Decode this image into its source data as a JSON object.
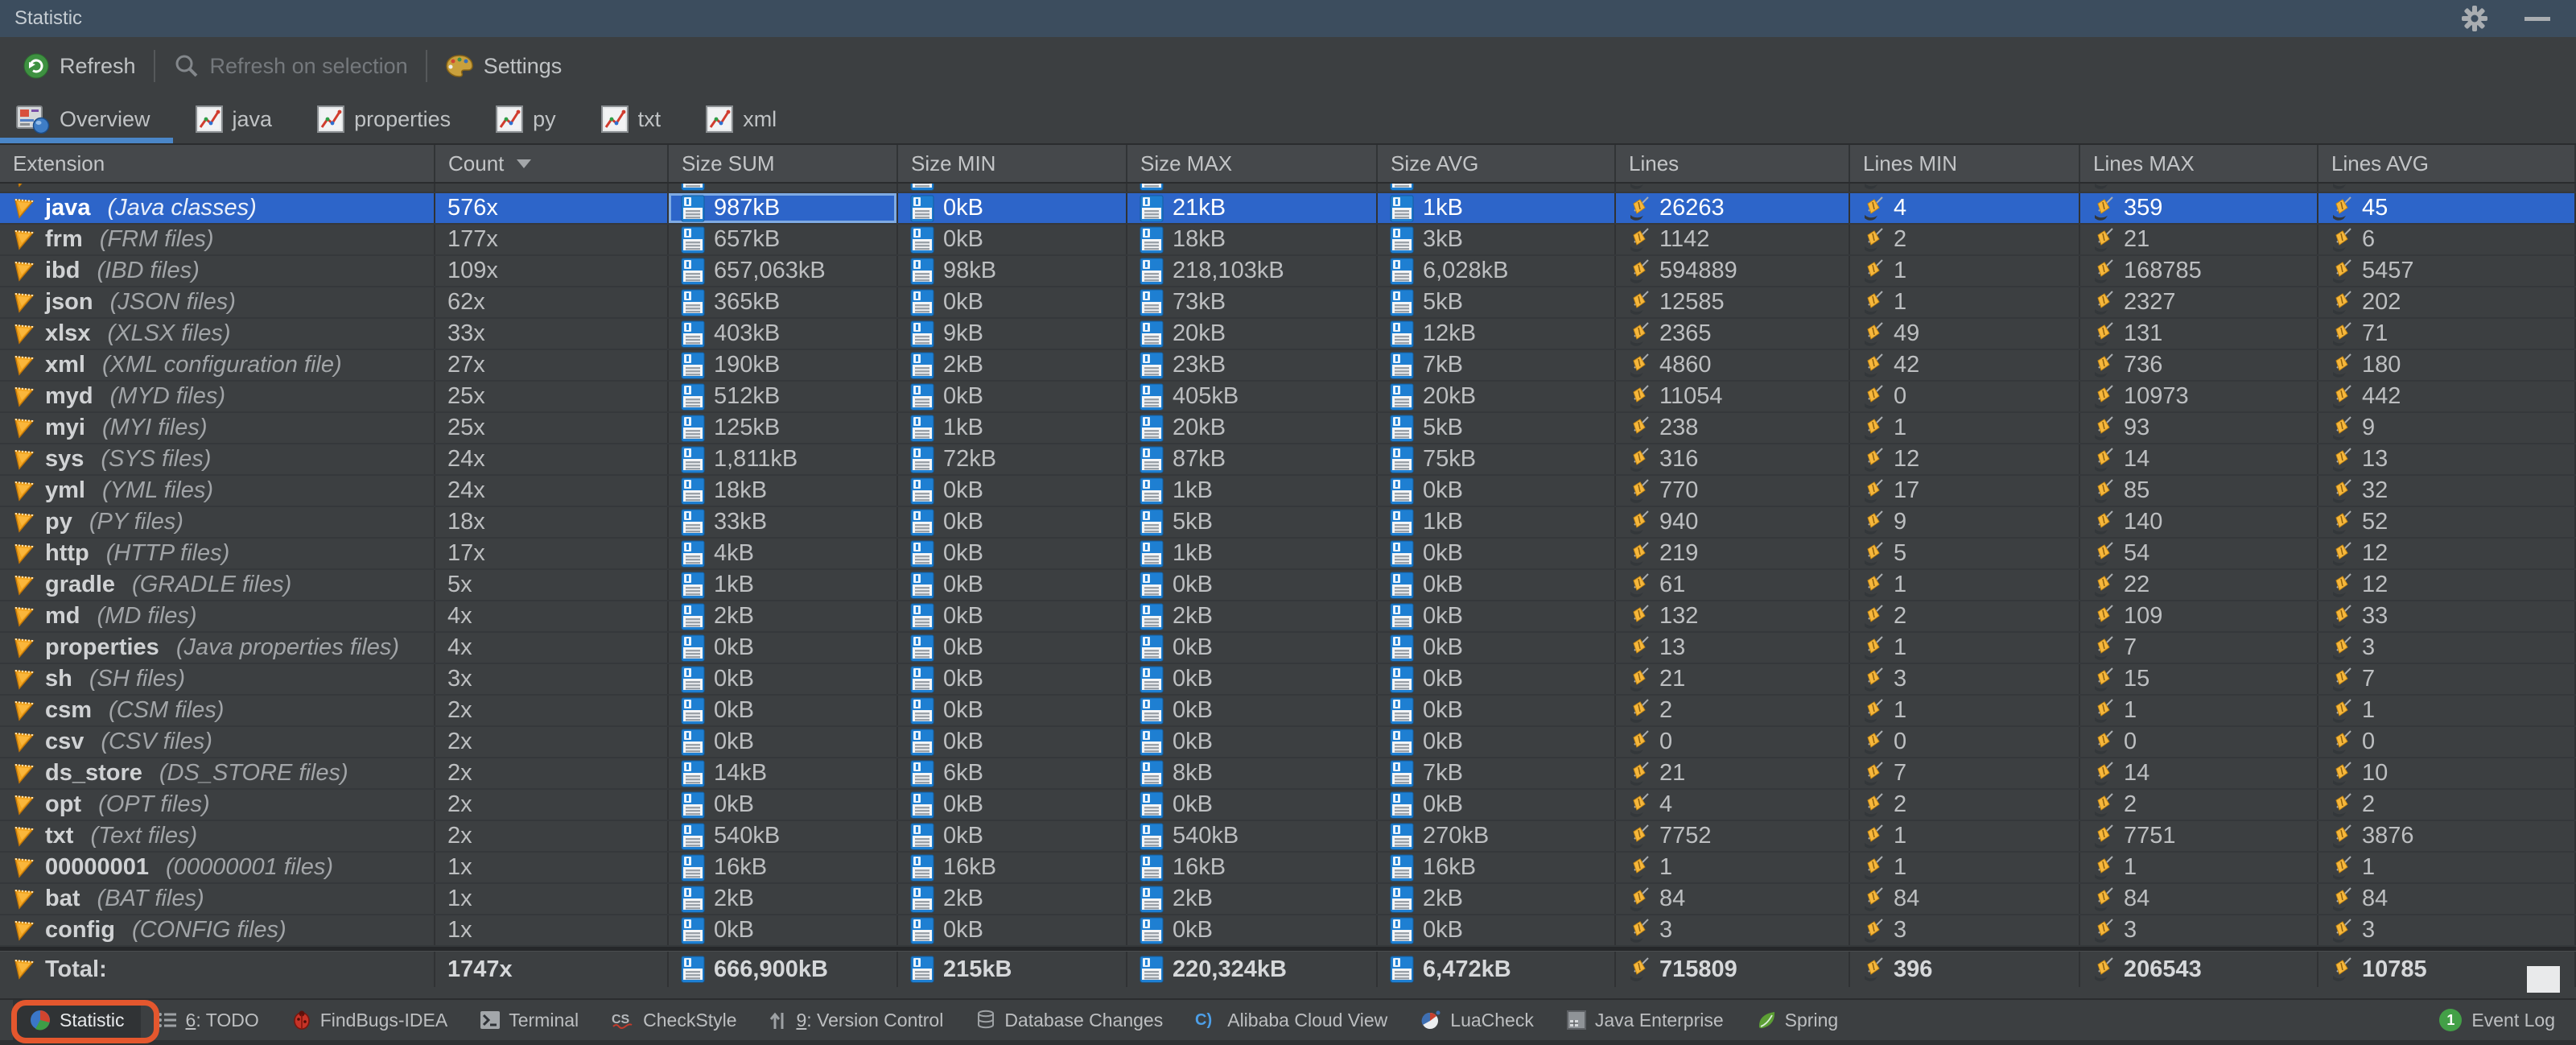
{
  "window": {
    "title": "Statistic"
  },
  "toolbar": {
    "items": [
      {
        "name": "refresh-button",
        "icon": "refresh",
        "label": "Refresh",
        "enabled": true
      },
      {
        "name": "refresh-on-selection-button",
        "icon": "search",
        "label": "Refresh on selection",
        "enabled": false
      },
      {
        "name": "settings-button",
        "icon": "palette",
        "label": "Settings",
        "enabled": true
      }
    ]
  },
  "tabs": [
    {
      "label": "Overview",
      "icon": "overview",
      "selected": true
    },
    {
      "label": "java",
      "icon": "chart",
      "selected": false
    },
    {
      "label": "properties",
      "icon": "chart",
      "selected": false
    },
    {
      "label": "py",
      "icon": "chart",
      "selected": false
    },
    {
      "label": "txt",
      "icon": "chart",
      "selected": false
    },
    {
      "label": "xml",
      "icon": "chart",
      "selected": false
    }
  ],
  "table": {
    "columns": [
      {
        "label": "Extension"
      },
      {
        "label": "Count",
        "sort": "desc"
      },
      {
        "label": "Size SUM"
      },
      {
        "label": "Size MIN"
      },
      {
        "label": "Size MAX"
      },
      {
        "label": "Size AVG"
      },
      {
        "label": "Lines"
      },
      {
        "label": "Lines MIN"
      },
      {
        "label": "Lines MAX"
      },
      {
        "label": "Lines AVG"
      }
    ],
    "has_clipped_top_row": true,
    "rows": [
      {
        "ext": "java",
        "desc": "(Java classes)",
        "count": "576x",
        "size_sum": "987kB",
        "size_min": "0kB",
        "size_max": "21kB",
        "size_avg": "1kB",
        "lines": "26263",
        "lines_min": "4",
        "lines_max": "359",
        "lines_avg": "45",
        "selected": true
      },
      {
        "ext": "frm",
        "desc": "(FRM files)",
        "count": "177x",
        "size_sum": "657kB",
        "size_min": "0kB",
        "size_max": "18kB",
        "size_avg": "3kB",
        "lines": "1142",
        "lines_min": "2",
        "lines_max": "21",
        "lines_avg": "6"
      },
      {
        "ext": "ibd",
        "desc": "(IBD files)",
        "count": "109x",
        "size_sum": "657,063kB",
        "size_min": "98kB",
        "size_max": "218,103kB",
        "size_avg": "6,028kB",
        "lines": "594889",
        "lines_min": "1",
        "lines_max": "168785",
        "lines_avg": "5457"
      },
      {
        "ext": "json",
        "desc": "(JSON files)",
        "count": "62x",
        "size_sum": "365kB",
        "size_min": "0kB",
        "size_max": "73kB",
        "size_avg": "5kB",
        "lines": "12585",
        "lines_min": "1",
        "lines_max": "2327",
        "lines_avg": "202"
      },
      {
        "ext": "xlsx",
        "desc": "(XLSX files)",
        "count": "33x",
        "size_sum": "403kB",
        "size_min": "9kB",
        "size_max": "20kB",
        "size_avg": "12kB",
        "lines": "2365",
        "lines_min": "49",
        "lines_max": "131",
        "lines_avg": "71"
      },
      {
        "ext": "xml",
        "desc": "(XML configuration file)",
        "count": "27x",
        "size_sum": "190kB",
        "size_min": "2kB",
        "size_max": "23kB",
        "size_avg": "7kB",
        "lines": "4860",
        "lines_min": "42",
        "lines_max": "736",
        "lines_avg": "180"
      },
      {
        "ext": "myd",
        "desc": "(MYD files)",
        "count": "25x",
        "size_sum": "512kB",
        "size_min": "0kB",
        "size_max": "405kB",
        "size_avg": "20kB",
        "lines": "11054",
        "lines_min": "0",
        "lines_max": "10973",
        "lines_avg": "442"
      },
      {
        "ext": "myi",
        "desc": "(MYI files)",
        "count": "25x",
        "size_sum": "125kB",
        "size_min": "1kB",
        "size_max": "20kB",
        "size_avg": "5kB",
        "lines": "238",
        "lines_min": "1",
        "lines_max": "93",
        "lines_avg": "9"
      },
      {
        "ext": "sys",
        "desc": "(SYS files)",
        "count": "24x",
        "size_sum": "1,811kB",
        "size_min": "72kB",
        "size_max": "87kB",
        "size_avg": "75kB",
        "lines": "316",
        "lines_min": "12",
        "lines_max": "14",
        "lines_avg": "13"
      },
      {
        "ext": "yml",
        "desc": "(YML files)",
        "count": "24x",
        "size_sum": "18kB",
        "size_min": "0kB",
        "size_max": "1kB",
        "size_avg": "0kB",
        "lines": "770",
        "lines_min": "17",
        "lines_max": "85",
        "lines_avg": "32"
      },
      {
        "ext": "py",
        "desc": "(PY files)",
        "count": "18x",
        "size_sum": "33kB",
        "size_min": "0kB",
        "size_max": "5kB",
        "size_avg": "1kB",
        "lines": "940",
        "lines_min": "9",
        "lines_max": "140",
        "lines_avg": "52"
      },
      {
        "ext": "http",
        "desc": "(HTTP files)",
        "count": "17x",
        "size_sum": "4kB",
        "size_min": "0kB",
        "size_max": "1kB",
        "size_avg": "0kB",
        "lines": "219",
        "lines_min": "5",
        "lines_max": "54",
        "lines_avg": "12"
      },
      {
        "ext": "gradle",
        "desc": "(GRADLE files)",
        "count": "5x",
        "size_sum": "1kB",
        "size_min": "0kB",
        "size_max": "0kB",
        "size_avg": "0kB",
        "lines": "61",
        "lines_min": "1",
        "lines_max": "22",
        "lines_avg": "12"
      },
      {
        "ext": "md",
        "desc": "(MD files)",
        "count": "4x",
        "size_sum": "2kB",
        "size_min": "0kB",
        "size_max": "2kB",
        "size_avg": "0kB",
        "lines": "132",
        "lines_min": "2",
        "lines_max": "109",
        "lines_avg": "33"
      },
      {
        "ext": "properties",
        "desc": "(Java properties files)",
        "count": "4x",
        "size_sum": "0kB",
        "size_min": "0kB",
        "size_max": "0kB",
        "size_avg": "0kB",
        "lines": "13",
        "lines_min": "1",
        "lines_max": "7",
        "lines_avg": "3"
      },
      {
        "ext": "sh",
        "desc": "(SH files)",
        "count": "3x",
        "size_sum": "0kB",
        "size_min": "0kB",
        "size_max": "0kB",
        "size_avg": "0kB",
        "lines": "21",
        "lines_min": "3",
        "lines_max": "15",
        "lines_avg": "7"
      },
      {
        "ext": "csm",
        "desc": "(CSM files)",
        "count": "2x",
        "size_sum": "0kB",
        "size_min": "0kB",
        "size_max": "0kB",
        "size_avg": "0kB",
        "lines": "2",
        "lines_min": "1",
        "lines_max": "1",
        "lines_avg": "1"
      },
      {
        "ext": "csv",
        "desc": "(CSV files)",
        "count": "2x",
        "size_sum": "0kB",
        "size_min": "0kB",
        "size_max": "0kB",
        "size_avg": "0kB",
        "lines": "0",
        "lines_min": "0",
        "lines_max": "0",
        "lines_avg": "0"
      },
      {
        "ext": "ds_store",
        "desc": "(DS_STORE files)",
        "count": "2x",
        "size_sum": "14kB",
        "size_min": "6kB",
        "size_max": "8kB",
        "size_avg": "7kB",
        "lines": "21",
        "lines_min": "7",
        "lines_max": "14",
        "lines_avg": "10"
      },
      {
        "ext": "opt",
        "desc": "(OPT files)",
        "count": "2x",
        "size_sum": "0kB",
        "size_min": "0kB",
        "size_max": "0kB",
        "size_avg": "0kB",
        "lines": "4",
        "lines_min": "2",
        "lines_max": "2",
        "lines_avg": "2"
      },
      {
        "ext": "txt",
        "desc": "(Text files)",
        "count": "2x",
        "size_sum": "540kB",
        "size_min": "0kB",
        "size_max": "540kB",
        "size_avg": "270kB",
        "lines": "7752",
        "lines_min": "1",
        "lines_max": "7751",
        "lines_avg": "3876"
      },
      {
        "ext": "00000001",
        "desc": "(00000001 files)",
        "count": "1x",
        "size_sum": "16kB",
        "size_min": "16kB",
        "size_max": "16kB",
        "size_avg": "16kB",
        "lines": "1",
        "lines_min": "1",
        "lines_max": "1",
        "lines_avg": "1"
      },
      {
        "ext": "bat",
        "desc": "(BAT files)",
        "count": "1x",
        "size_sum": "2kB",
        "size_min": "2kB",
        "size_max": "2kB",
        "size_avg": "2kB",
        "lines": "84",
        "lines_min": "84",
        "lines_max": "84",
        "lines_avg": "84"
      },
      {
        "ext": "config",
        "desc": "(CONFIG files)",
        "count": "1x",
        "size_sum": "0kB",
        "size_min": "0kB",
        "size_max": "0kB",
        "size_avg": "0kB",
        "lines": "3",
        "lines_min": "3",
        "lines_max": "3",
        "lines_avg": "3"
      }
    ],
    "total": {
      "ext": "Total:",
      "desc": "",
      "count": "1747x",
      "size_sum": "666,900kB",
      "size_min": "215kB",
      "size_max": "220,324kB",
      "size_avg": "6,472kB",
      "lines": "715809",
      "lines_min": "396",
      "lines_max": "206543",
      "lines_avg": "10785"
    }
  },
  "statusbar": {
    "items": [
      {
        "label": "Statistic",
        "icon": "pie",
        "pressed": true,
        "annotated": true
      },
      {
        "label": "TODO",
        "prefix": "6",
        "icon": "todo"
      },
      {
        "label": "FindBugs-IDEA",
        "icon": "bug"
      },
      {
        "label": "Terminal",
        "icon": "terminal"
      },
      {
        "label": "CheckStyle",
        "icon": "checkstyle"
      },
      {
        "label": "Version Control",
        "prefix": "9",
        "icon": "vcs"
      },
      {
        "label": "Database Changes",
        "icon": "database"
      },
      {
        "label": "Alibaba Cloud View",
        "icon": "alibaba"
      },
      {
        "label": "LuaCheck",
        "icon": "luacheck"
      },
      {
        "label": "Java Enterprise",
        "icon": "javaee"
      },
      {
        "label": "Spring",
        "icon": "spring"
      }
    ],
    "event_log": {
      "label": "Event Log",
      "badge": "1"
    }
  },
  "colors": {
    "selection": "#2D65C9",
    "selected_cell_border": "#7FABE4",
    "tab_underline": "#4A86C8",
    "titlebar": "#3C4D5E",
    "annotation": "#E4572E",
    "event_badge": "#43A047"
  }
}
